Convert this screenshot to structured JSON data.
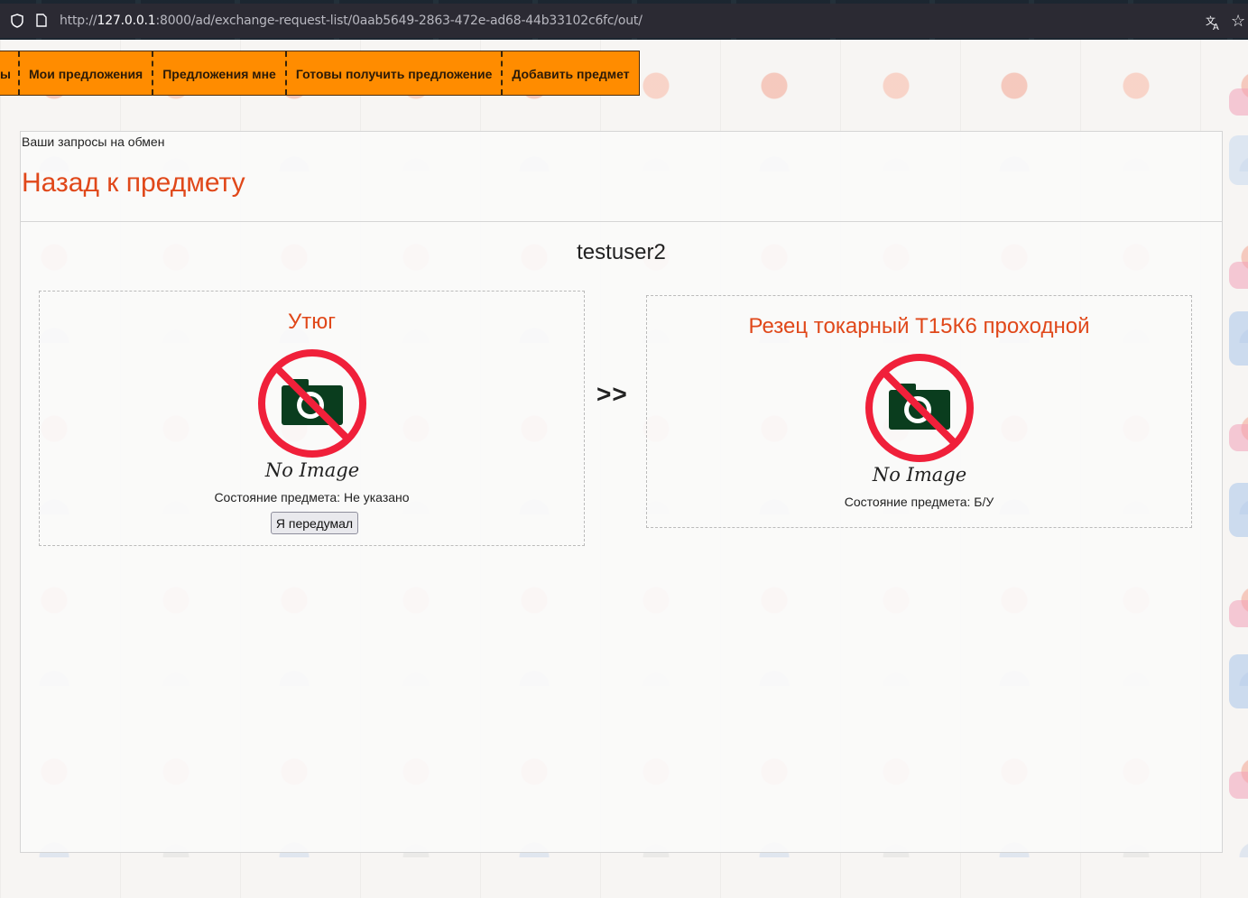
{
  "browser": {
    "url_prefix": "http://",
    "url_host": "127.0.0.1",
    "url_rest": ":8000/ad/exchange-request-list/0aab5649-2863-472e-ad68-44b33102c6fc/out/"
  },
  "nav": {
    "items": [
      {
        "label": "ы"
      },
      {
        "label": "Мои предложения"
      },
      {
        "label": "Предложения мне"
      },
      {
        "label": "Готовы получить предложение"
      },
      {
        "label": "Добавить предмет"
      }
    ],
    "accent": "#ff8c00"
  },
  "page": {
    "caption": "Ваши запросы на обмен",
    "back_link": "Назад к предмету",
    "username": "testuser2",
    "arrow": ">>"
  },
  "offer": {
    "left": {
      "title": "Утюг",
      "image_text": "No Image",
      "condition": "Состояние предмета: Не указано",
      "cancel_button": "Я передумал"
    },
    "right": {
      "title": "Резец токарный Т15К6 проходной",
      "image_text": "No Image",
      "condition": "Состояние предмета: Б/У"
    }
  },
  "colors": {
    "title_accent": "#e0481a",
    "no_image_red": "#f0203a",
    "camera_green": "#0a3d1e"
  }
}
